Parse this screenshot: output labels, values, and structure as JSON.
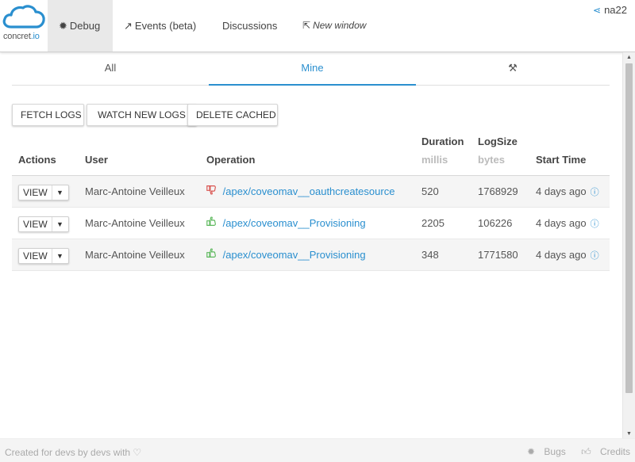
{
  "brand": {
    "name_main": "concret",
    "name_dot": ".",
    "name_io": "io"
  },
  "nav": {
    "debug": {
      "icon": "bug-icon",
      "label": "Debug"
    },
    "events": {
      "icon": "trending-icon",
      "label": "Events (beta)"
    },
    "discussions": {
      "label": "Discussions"
    },
    "new_window": {
      "icon": "external-link-icon",
      "label": "New window"
    },
    "org": {
      "icon": "share-icon",
      "label": "na22"
    }
  },
  "subtabs": {
    "all": "All",
    "mine": "Mine",
    "tools_icon": "tools-icon"
  },
  "buttons": {
    "fetch": "FETCH LOGS",
    "watch": "WATCH NEW LOGS",
    "delete": "DELETE CACHED"
  },
  "table": {
    "headers": {
      "actions": "Actions",
      "user": "User",
      "operation": "Operation",
      "duration": "Duration",
      "duration_unit": "millis",
      "logsize": "LogSize",
      "logsize_unit": "bytes",
      "start_time": "Start Time"
    },
    "rows": [
      {
        "action": "VIEW",
        "user": "Marc-Antoine Veilleux",
        "status": "failure",
        "operation": "/apex/coveomav__oauthcreatesource",
        "duration": "520",
        "logsize": "1768929",
        "start_time": "4 days ago"
      },
      {
        "action": "VIEW",
        "user": "Marc-Antoine Veilleux",
        "status": "success",
        "operation": "/apex/coveomav__Provisioning",
        "duration": "2205",
        "logsize": "106226",
        "start_time": "4 days ago"
      },
      {
        "action": "VIEW",
        "user": "Marc-Antoine Veilleux",
        "status": "success",
        "operation": "/apex/coveomav__Provisioning",
        "duration": "348",
        "logsize": "1771580",
        "start_time": "4 days ago"
      }
    ]
  },
  "footer": {
    "credit_text": "Created for devs by devs with",
    "bugs": "Bugs",
    "credits": "Credits"
  },
  "colors": {
    "accent": "#2a8fcf",
    "failure": "#d9534f",
    "success": "#5cb85c"
  }
}
